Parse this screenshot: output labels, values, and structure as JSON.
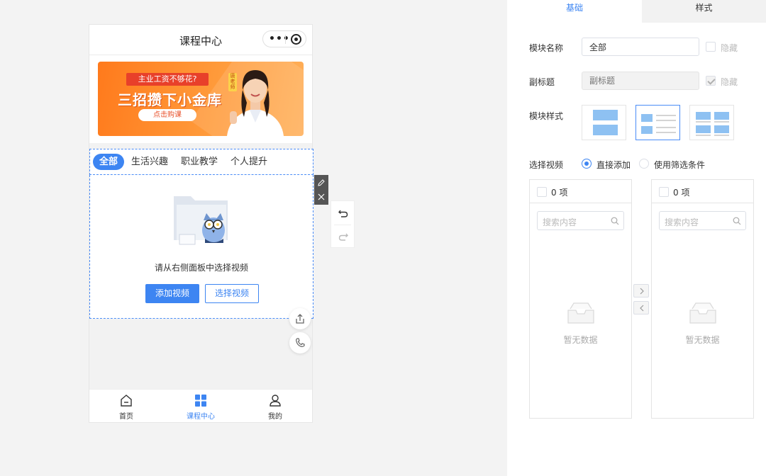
{
  "phone": {
    "title": "课程中心",
    "capsule_more": "•••",
    "banner": {
      "ribbon": "主业工资不够花?",
      "headline": "三招攒下小金库",
      "cta": "点击购课",
      "tag": "唐老师"
    },
    "tabs": [
      "全部",
      "生活兴趣",
      "职业教学",
      "个人提升"
    ],
    "empty_text": "请从右侧面板中选择视频",
    "add_button": "添加视频",
    "select_button": "选择视频",
    "tabbar": [
      {
        "label": "首页",
        "icon": "home-icon"
      },
      {
        "label": "课程中心",
        "icon": "grid-icon",
        "active": true
      },
      {
        "label": "我的",
        "icon": "user-icon"
      }
    ]
  },
  "panel": {
    "tabs": [
      "基础",
      "样式"
    ],
    "module_name_label": "模块名称",
    "module_name_value": "全部",
    "hide_label": "隐藏",
    "subtitle_label": "副标题",
    "subtitle_placeholder": "副标题",
    "module_style_label": "模块样式",
    "select_video_label": "选择视频",
    "radio_direct": "直接添加",
    "radio_filter": "使用筛选条件",
    "transfer_left": {
      "count": "0 项",
      "search_placeholder": "搜索内容",
      "empty": "暂无数据"
    },
    "transfer_right": {
      "count": "0 项",
      "search_placeholder": "搜索内容",
      "empty": "暂无数据"
    }
  },
  "colors": {
    "accent": "#3d85f2",
    "banner_orange": "#ff8a2a",
    "page_bg": "#f3f3f3"
  }
}
